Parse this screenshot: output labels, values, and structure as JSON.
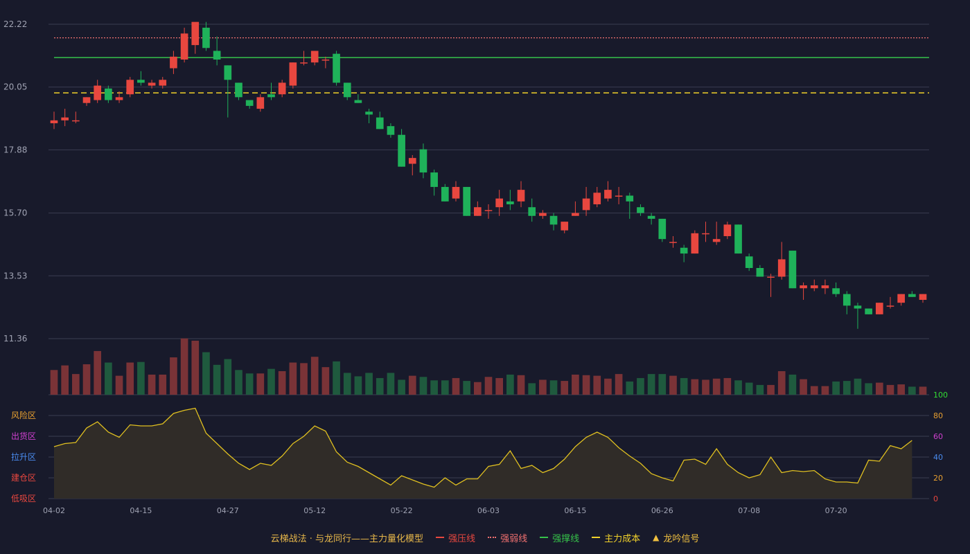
{
  "colors": {
    "background": "#181a2b",
    "grid": "#3a3d52",
    "axis_text": "#a0a3b3",
    "up": "#e8473f",
    "down": "#1fb25a",
    "vol_up": "#7a3337",
    "vol_down": "#1f5a3e",
    "resistance": "#e8473f",
    "weak": "#f07070",
    "support": "#36c24a",
    "cost": "#f2d22b",
    "indicator": "#e0c020",
    "indicator_fill": "#302c28",
    "right_axis": "#e8a030",
    "right_axis_green": "#33dd33",
    "right_axis_magenta": "#d040d0",
    "right_axis_blue": "#4a8cf0",
    "right_axis_red": "#e8473f"
  },
  "legend": {
    "title": "云梯战法 · 与龙同行——主力量化模型",
    "items": [
      {
        "label": "强压线",
        "color": "#e8473f",
        "style": "solid"
      },
      {
        "label": "强弱线",
        "color": "#f07070",
        "style": "dotted"
      },
      {
        "label": "强撑线",
        "color": "#36c24a",
        "style": "solid"
      },
      {
        "label": "主力成本",
        "color": "#f2d22b",
        "style": "dashed"
      },
      {
        "label": "龙吟信号",
        "color": "#f0c040",
        "style": "triangle"
      }
    ]
  },
  "zone_labels": [
    {
      "label": "风险区",
      "color": "#e8a030",
      "value": 80
    },
    {
      "label": "出货区",
      "color": "#d040d0",
      "value": 60
    },
    {
      "label": "拉升区",
      "color": "#4a8cf0",
      "value": 40
    },
    {
      "label": "建仓区",
      "color": "#e8473f",
      "value": 20
    },
    {
      "label": "低吸区",
      "color": "#e8473f",
      "value": 0
    }
  ],
  "chart_data": {
    "type": "candlestick",
    "price_axis": {
      "ticks": [
        "22.22",
        "20.05",
        "17.88",
        "15.70",
        "13.53",
        "11.36"
      ],
      "ylim": [
        11.36,
        22.22
      ]
    },
    "indicator_axis": {
      "ticks": [
        "100",
        "80",
        "60",
        "40",
        "20",
        "0"
      ],
      "ylim": [
        0,
        100
      ]
    },
    "x_ticks": [
      {
        "label": "04-02",
        "index": 0
      },
      {
        "label": "04-15",
        "index": 8
      },
      {
        "label": "04-27",
        "index": 16
      },
      {
        "label": "05-12",
        "index": 24
      },
      {
        "label": "05-22",
        "index": 32
      },
      {
        "label": "06-03",
        "index": 40
      },
      {
        "label": "06-15",
        "index": 48
      },
      {
        "label": "06-26",
        "index": 56
      },
      {
        "label": "07-08",
        "index": 64
      },
      {
        "label": "07-20",
        "index": 72
      }
    ],
    "reference_lines": {
      "weak_line": 21.75,
      "support_line": 21.07,
      "main_cost": 19.85
    },
    "ohlc": [
      [
        18.8,
        18.9,
        18.6,
        19.2
      ],
      [
        18.9,
        19.0,
        18.7,
        19.3
      ],
      [
        18.9,
        18.9,
        18.8,
        19.2
      ],
      [
        19.5,
        19.7,
        19.4,
        19.7
      ],
      [
        19.6,
        20.1,
        19.5,
        20.3
      ],
      [
        20.0,
        19.6,
        19.5,
        20.1
      ],
      [
        19.6,
        19.7,
        19.5,
        19.9
      ],
      [
        19.8,
        20.3,
        19.7,
        20.4
      ],
      [
        20.3,
        20.2,
        20.1,
        20.6
      ],
      [
        20.1,
        20.2,
        20.0,
        20.3
      ],
      [
        20.1,
        20.3,
        20.0,
        20.4
      ],
      [
        20.7,
        21.1,
        20.5,
        21.3
      ],
      [
        21.0,
        21.9,
        20.9,
        22.1
      ],
      [
        21.5,
        22.3,
        21.2,
        22.2
      ],
      [
        22.1,
        21.4,
        21.3,
        22.3
      ],
      [
        21.3,
        21.0,
        20.8,
        21.8
      ],
      [
        20.8,
        20.3,
        19.0,
        20.8
      ],
      [
        20.2,
        19.7,
        19.6,
        20.2
      ],
      [
        19.6,
        19.4,
        19.3,
        19.6
      ],
      [
        19.3,
        19.7,
        19.2,
        19.8
      ],
      [
        19.8,
        19.7,
        19.6,
        20.2
      ],
      [
        19.8,
        20.2,
        19.7,
        20.3
      ],
      [
        20.1,
        20.9,
        20.0,
        20.9
      ],
      [
        20.9,
        20.9,
        20.8,
        21.3
      ],
      [
        20.9,
        21.3,
        20.8,
        21.3
      ],
      [
        21.0,
        21.0,
        20.7,
        21.1
      ],
      [
        21.2,
        20.2,
        20.1,
        21.3
      ],
      [
        20.2,
        19.7,
        19.6,
        20.2
      ],
      [
        19.6,
        19.5,
        19.5,
        19.8
      ],
      [
        19.2,
        19.1,
        18.8,
        19.3
      ],
      [
        19.0,
        18.6,
        18.6,
        19.2
      ],
      [
        18.7,
        18.4,
        18.3,
        18.8
      ],
      [
        18.4,
        17.3,
        17.3,
        18.6
      ],
      [
        17.4,
        17.6,
        17.0,
        17.7
      ],
      [
        17.9,
        17.1,
        16.9,
        18.1
      ],
      [
        17.1,
        16.6,
        16.3,
        17.2
      ],
      [
        16.6,
        16.1,
        16.1,
        16.7
      ],
      [
        16.2,
        16.6,
        16.1,
        16.8
      ],
      [
        16.6,
        15.6,
        15.6,
        16.6
      ],
      [
        15.6,
        15.9,
        15.6,
        16.1
      ],
      [
        15.8,
        15.8,
        15.5,
        16.0
      ],
      [
        15.9,
        16.2,
        15.6,
        16.5
      ],
      [
        16.1,
        16.0,
        15.8,
        16.5
      ],
      [
        16.1,
        16.5,
        15.9,
        16.8
      ],
      [
        15.9,
        15.6,
        15.4,
        16.2
      ],
      [
        15.6,
        15.7,
        15.5,
        15.8
      ],
      [
        15.6,
        15.3,
        15.1,
        15.7
      ],
      [
        15.1,
        15.4,
        15.0,
        15.4
      ],
      [
        15.6,
        15.7,
        15.6,
        16.1
      ],
      [
        15.8,
        16.2,
        15.6,
        16.6
      ],
      [
        16.0,
        16.4,
        15.9,
        16.6
      ],
      [
        16.2,
        16.5,
        16.1,
        16.8
      ],
      [
        16.3,
        16.3,
        16.0,
        16.6
      ],
      [
        16.3,
        16.1,
        15.5,
        16.4
      ],
      [
        15.9,
        15.7,
        15.6,
        16.0
      ],
      [
        15.6,
        15.5,
        15.3,
        15.7
      ],
      [
        15.5,
        14.8,
        14.7,
        15.5
      ],
      [
        14.7,
        14.7,
        14.5,
        14.9
      ],
      [
        14.5,
        14.3,
        14.0,
        14.6
      ],
      [
        14.3,
        15.0,
        14.3,
        15.1
      ],
      [
        15.0,
        15.0,
        14.7,
        15.4
      ],
      [
        14.7,
        14.8,
        14.6,
        15.4
      ],
      [
        14.9,
        15.3,
        14.8,
        15.4
      ],
      [
        15.3,
        14.3,
        14.3,
        15.3
      ],
      [
        14.2,
        13.8,
        13.7,
        14.3
      ],
      [
        13.8,
        13.5,
        13.5,
        13.9
      ],
      [
        13.5,
        13.5,
        12.8,
        13.6
      ],
      [
        13.5,
        14.1,
        13.4,
        14.7
      ],
      [
        14.4,
        13.1,
        13.1,
        14.4
      ],
      [
        13.1,
        13.2,
        12.7,
        13.3
      ],
      [
        13.1,
        13.2,
        13.0,
        13.4
      ],
      [
        13.1,
        13.2,
        12.9,
        13.4
      ],
      [
        13.1,
        12.9,
        12.8,
        13.3
      ],
      [
        12.9,
        12.5,
        12.2,
        13.0
      ],
      [
        12.5,
        12.4,
        11.7,
        12.6
      ],
      [
        12.4,
        12.2,
        12.2,
        12.4
      ],
      [
        12.2,
        12.6,
        12.2,
        12.6
      ],
      [
        12.5,
        12.5,
        12.4,
        12.8
      ],
      [
        12.6,
        12.9,
        12.5,
        12.9
      ],
      [
        12.9,
        12.8,
        12.8,
        13.0
      ],
      [
        12.7,
        12.9,
        12.6,
        12.9
      ]
    ],
    "volume": [
      0.43,
      0.51,
      0.36,
      0.53,
      0.76,
      0.56,
      0.33,
      0.56,
      0.57,
      0.35,
      0.35,
      0.65,
      0.98,
      0.94,
      0.74,
      0.52,
      0.62,
      0.43,
      0.37,
      0.37,
      0.45,
      0.41,
      0.56,
      0.55,
      0.66,
      0.48,
      0.58,
      0.38,
      0.32,
      0.38,
      0.29,
      0.38,
      0.26,
      0.33,
      0.31,
      0.25,
      0.25,
      0.29,
      0.24,
      0.22,
      0.31,
      0.29,
      0.35,
      0.34,
      0.2,
      0.26,
      0.25,
      0.24,
      0.35,
      0.34,
      0.33,
      0.28,
      0.36,
      0.23,
      0.29,
      0.36,
      0.36,
      0.33,
      0.29,
      0.27,
      0.26,
      0.28,
      0.29,
      0.25,
      0.21,
      0.17,
      0.17,
      0.41,
      0.35,
      0.27,
      0.15,
      0.15,
      0.23,
      0.24,
      0.28,
      0.2,
      0.21,
      0.17,
      0.18,
      0.14,
      0.14
    ],
    "indicator": [
      50,
      53,
      54,
      68,
      74,
      64,
      59,
      71,
      70,
      70,
      72,
      82,
      85,
      87,
      63,
      53,
      43,
      34,
      28,
      34,
      32,
      41,
      53,
      60,
      70,
      65,
      45,
      35,
      31,
      25,
      19,
      13,
      22,
      18,
      14,
      11,
      20,
      13,
      19,
      19,
      31,
      33,
      46,
      29,
      32,
      25,
      29,
      38,
      50,
      59,
      64,
      59,
      49,
      41,
      34,
      24,
      20,
      17,
      37,
      38,
      33,
      48,
      33,
      25,
      20,
      23,
      40,
      25,
      27,
      26,
      27,
      19,
      16,
      16,
      15,
      37,
      36,
      51,
      48,
      56
    ]
  }
}
